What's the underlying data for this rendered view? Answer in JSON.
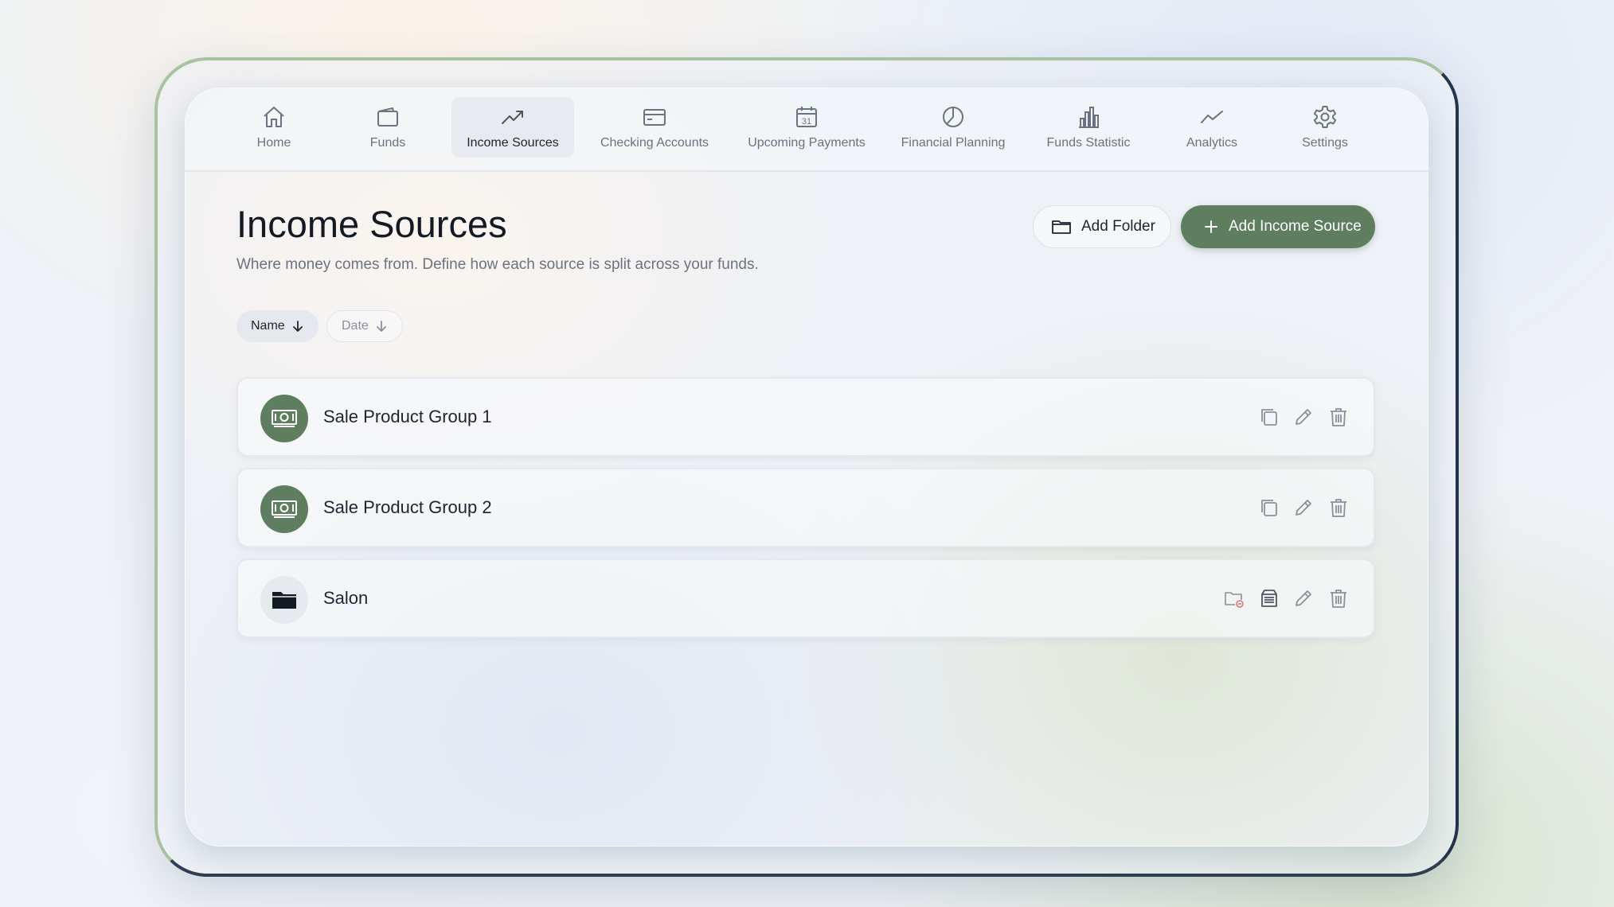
{
  "nav": {
    "items": [
      {
        "label": "Home",
        "icon": "home-icon"
      },
      {
        "label": "Funds",
        "icon": "wallet-icon"
      },
      {
        "label": "Income Sources",
        "icon": "trending-up-icon",
        "active": true
      },
      {
        "label": "Checking Accounts",
        "icon": "card-icon"
      },
      {
        "label": "Upcoming Payments",
        "icon": "calendar-icon",
        "calendar_day": "31"
      },
      {
        "label": "Financial Planning",
        "icon": "pie-chart-icon"
      },
      {
        "label": "Funds Statistic",
        "icon": "bar-chart-icon"
      },
      {
        "label": "Analytics",
        "icon": "line-chart-icon"
      },
      {
        "label": "Settings",
        "icon": "gear-icon"
      }
    ]
  },
  "page": {
    "title": "Income Sources",
    "subtitle": "Where money comes from. Define how each source is split across your funds."
  },
  "toolbar": {
    "add_folder_label": "Add Folder",
    "add_income_label": "Add Income Source"
  },
  "sort": {
    "name_label": "Name",
    "date_label": "Date"
  },
  "list": {
    "items": [
      {
        "label": "Sale Product Group 1",
        "kind": "income-source"
      },
      {
        "label": "Sale Product Group 2",
        "kind": "income-source"
      },
      {
        "label": "Salon",
        "kind": "folder"
      }
    ]
  },
  "colors": {
    "accent": "#5f7d5f",
    "text": "#1e2530",
    "muted": "#6b7280"
  }
}
